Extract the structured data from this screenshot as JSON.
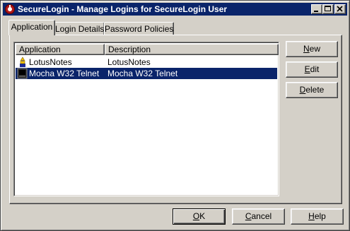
{
  "window": {
    "title": "SecureLogin - Manage Logins for SecureLogin User"
  },
  "tabs": [
    {
      "label": "Application"
    },
    {
      "label": "Login Details"
    },
    {
      "label": "Password Policies"
    }
  ],
  "list": {
    "columns": [
      "Application",
      "Description"
    ],
    "rows": [
      {
        "application": "LotusNotes",
        "description": "LotusNotes",
        "icon": "lotus-notes-icon",
        "selected": false
      },
      {
        "application": "Mocha W32 Telnet",
        "description": "Mocha W32 Telnet",
        "icon": "terminal-icon",
        "selected": true
      }
    ]
  },
  "side_buttons": {
    "new": {
      "mnemonic": "N",
      "rest": "ew"
    },
    "edit": {
      "mnemonic": "E",
      "rest": "dit"
    },
    "delete": {
      "mnemonic": "D",
      "rest": "elete"
    }
  },
  "footer_buttons": {
    "ok": {
      "mnemonic": "O",
      "rest": "K"
    },
    "cancel": {
      "mnemonic": "C",
      "rest": "ancel"
    },
    "help": {
      "mnemonic": "H",
      "rest": "elp"
    }
  },
  "colors": {
    "titlebar": "#0a246a",
    "selection": "#0a246a",
    "face": "#d4d0c8"
  }
}
